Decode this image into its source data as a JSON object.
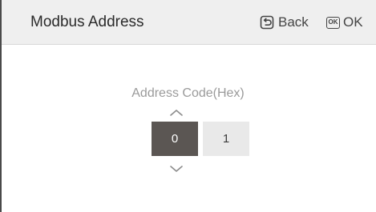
{
  "header": {
    "title": "Modbus Address",
    "back_label": "Back",
    "ok_icon_text": "OK",
    "ok_label": "OK"
  },
  "field": {
    "label": "Address Code(Hex)",
    "digits": [
      "0",
      "1"
    ],
    "selected_index": 0
  },
  "colors": {
    "header_bg": "#efefef",
    "selected_digit_bg": "#5b5653",
    "unselected_digit_bg": "#e9e9e9",
    "label_text": "#9a9a9a"
  },
  "icons": {
    "back": "back-return-icon",
    "ok": "ok-key-icon",
    "up": "chevron-up-icon",
    "down": "chevron-down-icon"
  }
}
